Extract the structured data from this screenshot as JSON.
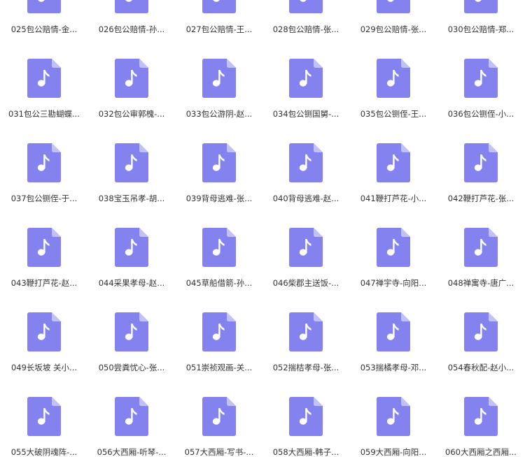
{
  "theme": {
    "icon_color": "#8482ee",
    "icon_fold_color": "#c2c0f8",
    "note_color": "#ffffff"
  },
  "files": [
    {
      "icon": "music-file-icon",
      "label": "025包公赔情-金..."
    },
    {
      "icon": "music-file-icon",
      "label": "026包公赔情-孙..."
    },
    {
      "icon": "music-file-icon",
      "label": "027包公赔情-王..."
    },
    {
      "icon": "music-file-icon",
      "label": "028包公赔情-张..."
    },
    {
      "icon": "music-file-icon",
      "label": "029包公赔情-张..."
    },
    {
      "icon": "music-file-icon",
      "label": "030包公赔情-郑..."
    },
    {
      "icon": "music-file-icon",
      "label": "031包公三勘蝴蝶..."
    },
    {
      "icon": "music-file-icon",
      "label": "032包公审郭槐-..."
    },
    {
      "icon": "music-file-icon",
      "label": "033包公游阴-赵..."
    },
    {
      "icon": "music-file-icon",
      "label": "034包公铡国舅-..."
    },
    {
      "icon": "music-file-icon",
      "label": "035包公铡侄-王..."
    },
    {
      "icon": "music-file-icon",
      "label": "036包公铡侄-小..."
    },
    {
      "icon": "music-file-icon",
      "label": "037包公铡侄-于..."
    },
    {
      "icon": "music-file-icon",
      "label": "038宝玉吊孝-胡..."
    },
    {
      "icon": "music-file-icon",
      "label": "039背母逃难-张..."
    },
    {
      "icon": "music-file-icon",
      "label": "040背母逃难-赵..."
    },
    {
      "icon": "music-file-icon",
      "label": "041鞭打芦花-小..."
    },
    {
      "icon": "music-file-icon",
      "label": "042鞭打芦花-张..."
    },
    {
      "icon": "music-file-icon",
      "label": "043鞭打芦花-赵..."
    },
    {
      "icon": "music-file-icon",
      "label": "044采果孝母-赵..."
    },
    {
      "icon": "music-file-icon",
      "label": "045草船借箭-孙..."
    },
    {
      "icon": "music-file-icon",
      "label": "046柴郡主送饭-..."
    },
    {
      "icon": "music-file-icon",
      "label": "047禅宇寺-向阳..."
    },
    {
      "icon": "music-file-icon",
      "label": "048禅寓寺-唐广..."
    },
    {
      "icon": "music-file-icon",
      "label": "049长坂坡 关小..."
    },
    {
      "icon": "music-file-icon",
      "label": "050尝粪忧心-张..."
    },
    {
      "icon": "music-file-icon",
      "label": "051崇祯观画-关..."
    },
    {
      "icon": "music-file-icon",
      "label": "052揣桔孝母-张..."
    },
    {
      "icon": "music-file-icon",
      "label": "053揣橘孝母-邓..."
    },
    {
      "icon": "music-file-icon",
      "label": "054春秋配-赵小..."
    },
    {
      "icon": "music-file-icon",
      "label": "055大破阴魂阵-..."
    },
    {
      "icon": "music-file-icon",
      "label": "056大西厢-听琴-..."
    },
    {
      "icon": "music-file-icon",
      "label": "057大西厢-写书-..."
    },
    {
      "icon": "music-file-icon",
      "label": "058大西厢-韩子..."
    },
    {
      "icon": "music-file-icon",
      "label": "059大西厢-向阳..."
    },
    {
      "icon": "music-file-icon",
      "label": "060大西厢之西厢..."
    }
  ]
}
